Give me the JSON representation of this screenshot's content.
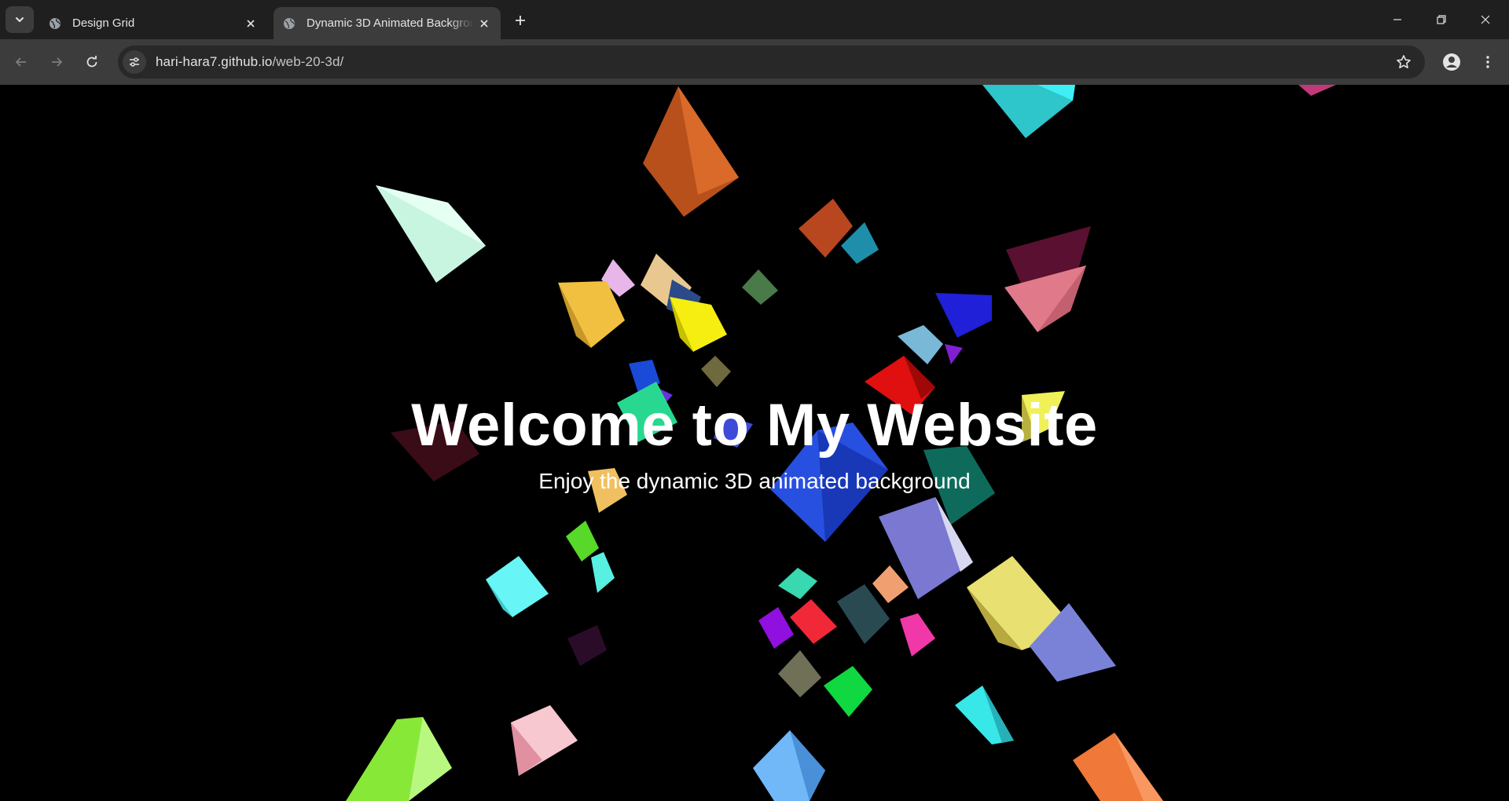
{
  "browser": {
    "tabs": [
      {
        "title": "Design Grid",
        "active": false
      },
      {
        "title": "Dynamic 3D Animated Background",
        "active": true
      }
    ],
    "url_host": "hari-hara7.github.io",
    "url_path": "/web-20-3d/"
  },
  "page": {
    "title": "Welcome to My Website",
    "subtitle": "Enjoy the dynamic 3D animated background",
    "background_color": "#000000"
  },
  "icons": {
    "tab_search": "chevron-down-icon",
    "favicon": "globe-icon",
    "close": "close-icon",
    "new_tab": "plus-icon",
    "back": "arrow-left-icon",
    "forward": "arrow-right-icon",
    "reload": "reload-icon",
    "site_info": "tune-icon",
    "bookmark": "star-icon",
    "profile": "person-icon",
    "menu": "kebab-menu-icon",
    "minimize": "minimize-icon",
    "restore": "restore-icon",
    "close_window": "close-window-icon"
  }
}
